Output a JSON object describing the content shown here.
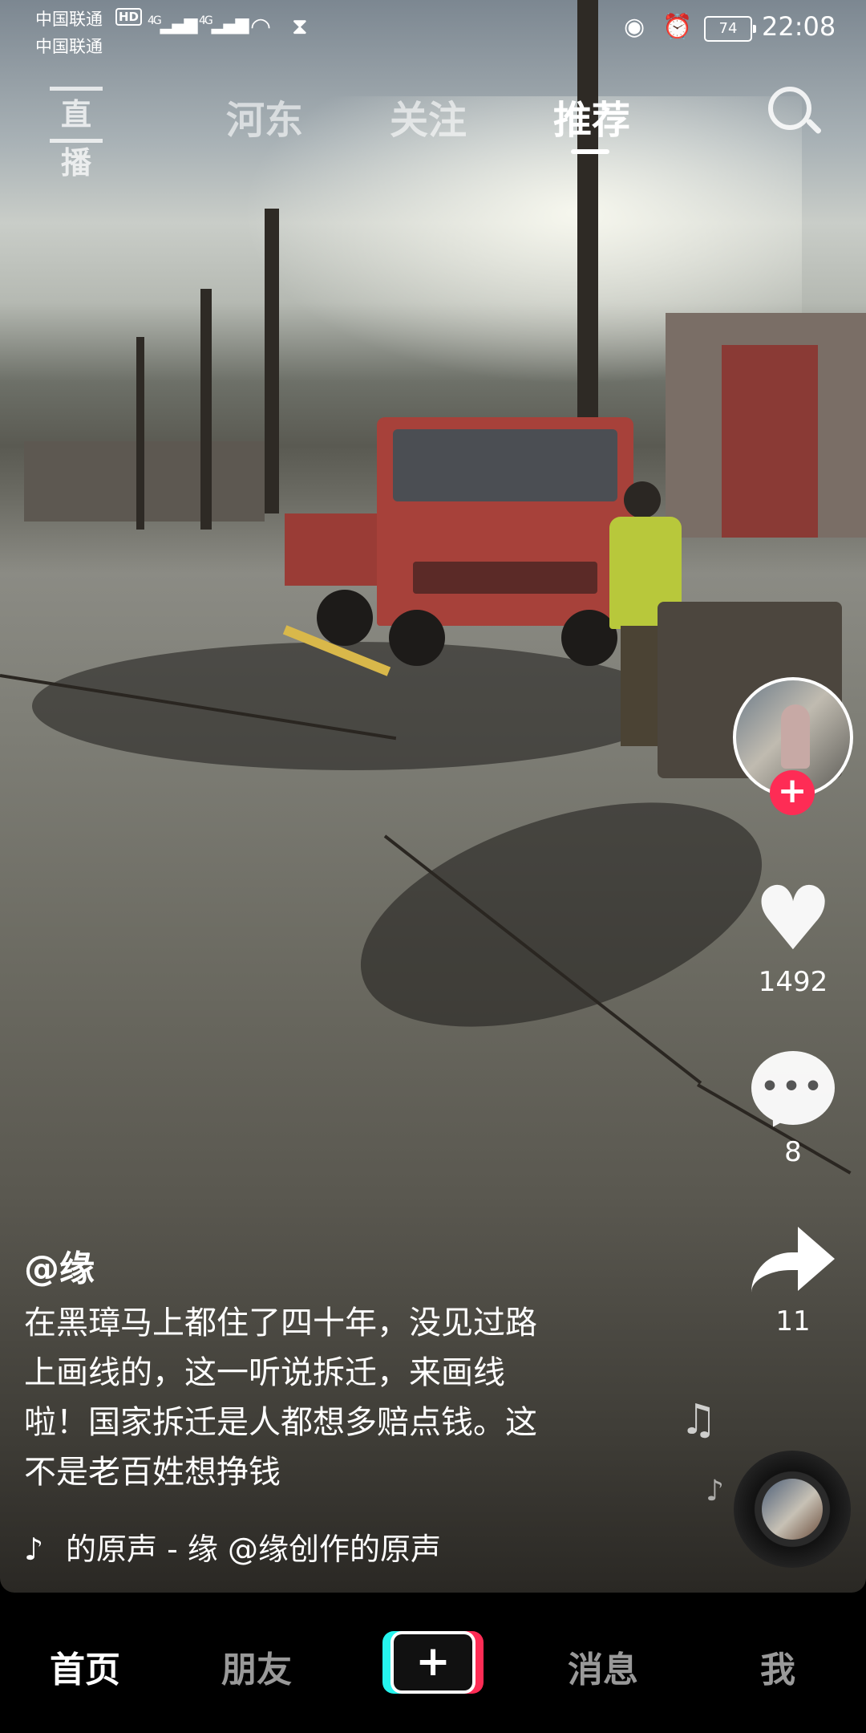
{
  "status_bar": {
    "carrier_1": "中国联通",
    "carrier_2": "中国联通",
    "hd_badge": "HD",
    "signal_1": "4G",
    "signal_2": "4G",
    "battery": "74",
    "time": "22:08"
  },
  "top_nav": {
    "live_label": "直播",
    "tabs": [
      {
        "label": "河东",
        "active": false
      },
      {
        "label": "关注",
        "active": false
      },
      {
        "label": "推荐",
        "active": true
      }
    ]
  },
  "side_actions": {
    "likes": "1492",
    "comments": "8",
    "shares": "11"
  },
  "post": {
    "author": "@缘",
    "caption_lines": [
      "在黑璋马上都住了四十年，没见过路",
      "上画线的，这一听说拆迁，来画线",
      "啦！国家拆迁是人都想多赔点钱。这",
      "不是老百姓想挣钱"
    ],
    "music": "的原声 - 缘    @缘创作的原声"
  },
  "bottom_nav": {
    "items": [
      {
        "label": "首页",
        "active": true
      },
      {
        "label": "朋友",
        "active": false
      },
      {
        "label": "+",
        "active": false
      },
      {
        "label": "消息",
        "active": false
      },
      {
        "label": "我",
        "active": false
      }
    ]
  },
  "colors": {
    "accent": "#fe2c55",
    "accent_cyan": "#25f4ee",
    "background": "#000000"
  },
  "icons": [
    "live-icon",
    "search-icon",
    "heart-icon",
    "comment-icon",
    "share-icon",
    "music-note-icon",
    "tiktok-icon",
    "music-disc-icon",
    "plus-icon"
  ]
}
